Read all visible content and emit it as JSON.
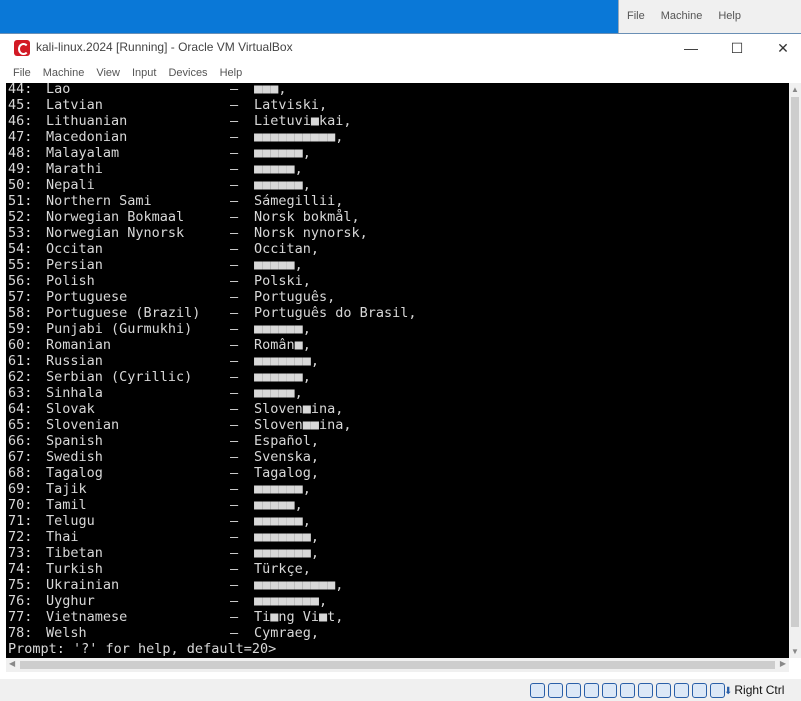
{
  "background_window": {
    "menu": [
      "File",
      "Machine",
      "Help"
    ]
  },
  "window": {
    "title": "kali-linux.2024 [Running] - Oracle VM VirtualBox",
    "controls": {
      "minimize": "—",
      "maximize": "☐",
      "close": "✕"
    },
    "menu": [
      "File",
      "Machine",
      "View",
      "Input",
      "Devices",
      "Help"
    ]
  },
  "terminal": {
    "lines": [
      {
        "num": "44:",
        "name": "Lao",
        "native": "■■■,"
      },
      {
        "num": "45:",
        "name": "Latvian",
        "native": "Latviski,"
      },
      {
        "num": "46:",
        "name": "Lithuanian",
        "native": "Lietuvi■kai,"
      },
      {
        "num": "47:",
        "name": "Macedonian",
        "native": "■■■■■■■■■■,"
      },
      {
        "num": "48:",
        "name": "Malayalam",
        "native": "■■■■■■,"
      },
      {
        "num": "49:",
        "name": "Marathi",
        "native": "■■■■■,"
      },
      {
        "num": "50:",
        "name": "Nepali",
        "native": "■■■■■■,"
      },
      {
        "num": "51:",
        "name": "Northern Sami",
        "native": "Sámegillii,"
      },
      {
        "num": "52:",
        "name": "Norwegian Bokmaal",
        "native": "Norsk bokmål,"
      },
      {
        "num": "53:",
        "name": "Norwegian Nynorsk",
        "native": "Norsk nynorsk,"
      },
      {
        "num": "54:",
        "name": "Occitan",
        "native": "Occitan,"
      },
      {
        "num": "55:",
        "name": "Persian",
        "native": "■■■■■,"
      },
      {
        "num": "56:",
        "name": "Polish",
        "native": "Polski,"
      },
      {
        "num": "57:",
        "name": "Portuguese",
        "native": "Português,"
      },
      {
        "num": "58:",
        "name": "Portuguese (Brazil)",
        "native": "Português do Brasil,"
      },
      {
        "num": "59:",
        "name": "Punjabi (Gurmukhi)",
        "native": "■■■■■■,"
      },
      {
        "num": "60:",
        "name": "Romanian",
        "native": "Român■,"
      },
      {
        "num": "61:",
        "name": "Russian",
        "native": "■■■■■■■,"
      },
      {
        "num": "62:",
        "name": "Serbian (Cyrillic)",
        "native": "■■■■■■,"
      },
      {
        "num": "63:",
        "name": "Sinhala",
        "native": "■■■■■,"
      },
      {
        "num": "64:",
        "name": "Slovak",
        "native": "Sloven■ina,"
      },
      {
        "num": "65:",
        "name": "Slovenian",
        "native": "Sloven■■ina,"
      },
      {
        "num": "66:",
        "name": "Spanish",
        "native": "Español,"
      },
      {
        "num": "67:",
        "name": "Swedish",
        "native": "Svenska,"
      },
      {
        "num": "68:",
        "name": "Tagalog",
        "native": "Tagalog,"
      },
      {
        "num": "69:",
        "name": "Tajik",
        "native": "■■■■■■,"
      },
      {
        "num": "70:",
        "name": "Tamil",
        "native": "■■■■■,"
      },
      {
        "num": "71:",
        "name": "Telugu",
        "native": "■■■■■■,"
      },
      {
        "num": "72:",
        "name": "Thai",
        "native": "■■■■■■■,"
      },
      {
        "num": "73:",
        "name": "Tibetan",
        "native": "■■■■■■■,"
      },
      {
        "num": "74:",
        "name": "Turkish",
        "native": "Türkçe,"
      },
      {
        "num": "75:",
        "name": "Ukrainian",
        "native": "■■■■■■■■■■,"
      },
      {
        "num": "76:",
        "name": "Uyghur",
        "native": "■■■■■■■■,"
      },
      {
        "num": "77:",
        "name": "Vietnamese",
        "native": "Ti■ng Vi■t,"
      },
      {
        "num": "78:",
        "name": "Welsh",
        "native": "Cymraeg,"
      }
    ],
    "separator": "–",
    "prompt": "Prompt: '?' for help, default=20>"
  },
  "statusbar": {
    "host_key": "Right Ctrl",
    "host_key_icon": "down-arrow-icon"
  },
  "colors": {
    "terminal_bg": "#000000",
    "terminal_fg": "#d8d8d8",
    "desktop": "#0a78d7"
  }
}
